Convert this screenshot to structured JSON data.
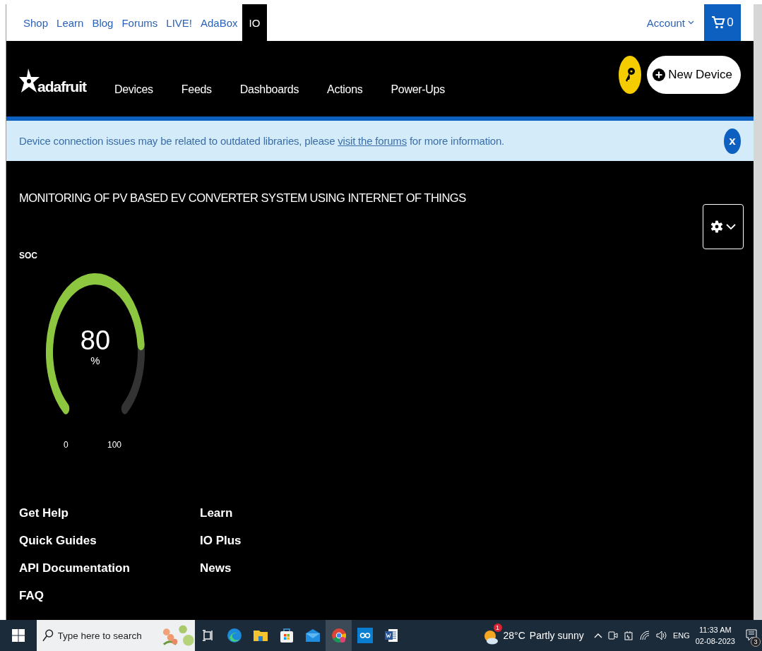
{
  "top_nav": {
    "links": [
      {
        "label": "Shop",
        "selected": false
      },
      {
        "label": "Learn",
        "selected": false
      },
      {
        "label": "Blog",
        "selected": false
      },
      {
        "label": "Forums",
        "selected": false
      },
      {
        "label": "LIVE!",
        "selected": false
      },
      {
        "label": "AdaBox",
        "selected": false
      },
      {
        "label": "IO",
        "selected": true
      }
    ],
    "account": "Account",
    "cart_count": "0"
  },
  "header": {
    "logo": "adafruit",
    "nav": [
      "Devices",
      "Feeds",
      "Dashboards",
      "Actions",
      "Power-Ups"
    ],
    "new_device": "New Device"
  },
  "alert": {
    "text_before": "Device connection issues may be related to outdated libraries, please ",
    "link": "visit the forums",
    "text_after": " for more information.",
    "close": "x"
  },
  "dashboard": {
    "title": "MONITORING OF PV BASED EV CONVERTER SYSTEM USING INTERNET OF THINGS",
    "gauge": {
      "label": "SOC",
      "value": "80",
      "unit": "%",
      "min": "0",
      "max": "100"
    }
  },
  "footer": {
    "columns": [
      [
        "Get Help",
        "Quick Guides",
        "API Documentation",
        "FAQ"
      ],
      [
        "Learn",
        "IO Plus",
        "News"
      ]
    ]
  },
  "taskbar": {
    "search_placeholder": "Type here to search",
    "apps": [
      {
        "kind": "taskview",
        "selected": false
      },
      {
        "kind": "edge",
        "selected": false
      },
      {
        "kind": "folder",
        "selected": false
      },
      {
        "kind": "store",
        "selected": false
      },
      {
        "kind": "mail",
        "selected": false
      },
      {
        "kind": "chrome",
        "selected": true
      },
      {
        "kind": "arduino",
        "selected": false
      },
      {
        "kind": "word",
        "selected": false
      }
    ],
    "weather": {
      "badge": "1",
      "temp": "28°C",
      "condition": "Partly sunny"
    },
    "language": "ENG",
    "time": "11:33 AM",
    "date": "02-08-2023",
    "notifications": "3"
  }
}
